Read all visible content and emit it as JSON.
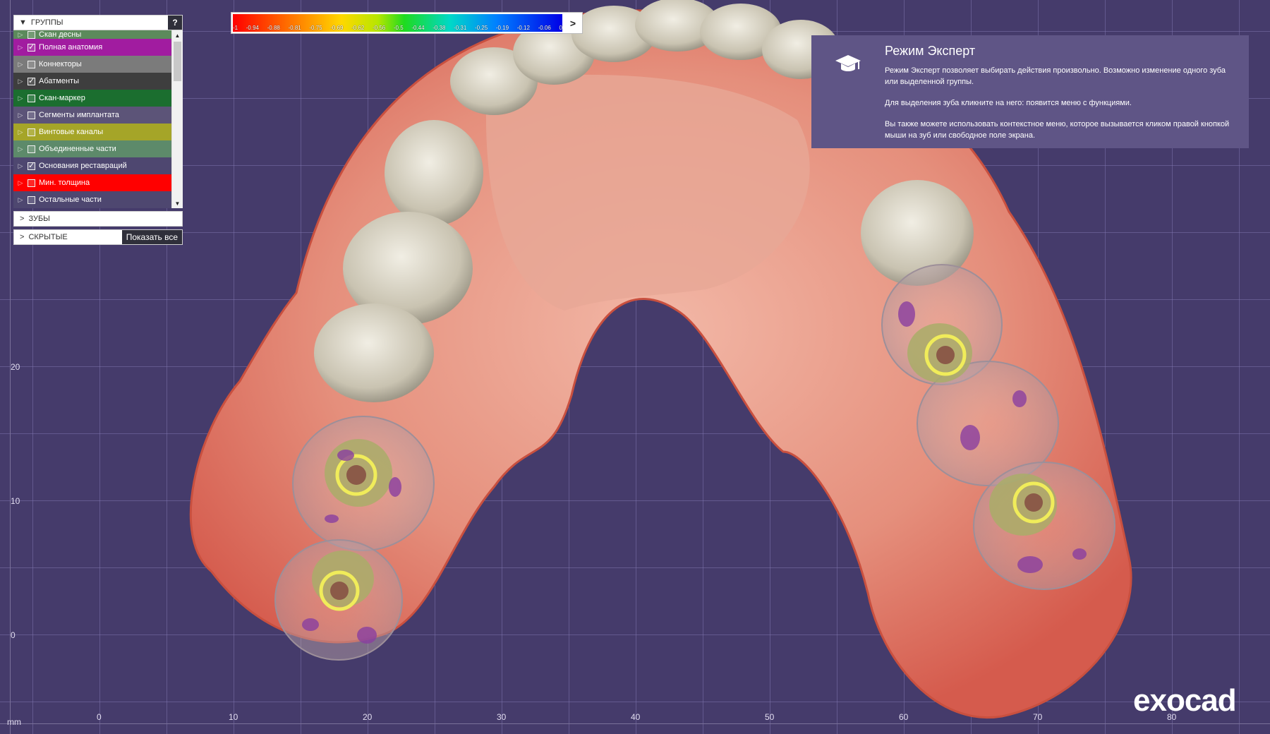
{
  "groups_panel": {
    "title": "ГРУППЫ",
    "help_label": "?",
    "partial_item": "Скан десны",
    "items": [
      {
        "label": "Полная анатомия",
        "checked": true,
        "color": "#a11ca0"
      },
      {
        "label": "Коннекторы",
        "checked": false,
        "color": "#7b7b7b"
      },
      {
        "label": "Абатменты",
        "checked": true,
        "color": "#3e3e3e"
      },
      {
        "label": "Скан-маркер",
        "checked": false,
        "color": "#1b6e2f"
      },
      {
        "label": "Сегменты имплантата",
        "checked": false,
        "color": "#5c5478"
      },
      {
        "label": "Винтовые каналы",
        "checked": false,
        "color": "#a5a528"
      },
      {
        "label": "Объединенные части",
        "checked": false,
        "color": "#5d8a6a"
      },
      {
        "label": "Основания реставраций",
        "checked": true,
        "color": "#4e4770"
      },
      {
        "label": "Мин. толщина",
        "checked": false,
        "color": "#ff0000"
      },
      {
        "label": "Остальные части",
        "checked": false,
        "color": "#4e4770"
      }
    ],
    "teeth_label": "ЗУБЫ",
    "hidden_label": "СКРЫТЫЕ",
    "show_all_label": "Показать все"
  },
  "color_scale": {
    "labels": [
      "-1",
      "-0.94",
      "-0.88",
      "-0.81",
      "-0.75",
      "-0.69",
      "-0.62",
      "-0.56",
      "-0.5",
      "-0.44",
      "-0.38",
      "-0.31",
      "-0.25",
      "-0.19",
      "-0.12",
      "-0.06",
      "0"
    ],
    "next_icon": "chevron-right-icon"
  },
  "expert_mode": {
    "icon": "graduation-cap-icon",
    "title": "Режим Эксперт",
    "paragraph1": "Режим Эксперт позволяет выбирать действия произвольно. Возможно изменение одного зуба или выделенной группы.",
    "paragraph2": "Для выделения зуба кликните на него: появится меню с функциями.",
    "paragraph3": "Вы также можете использовать контекстное меню, которое вызывается кликом правой кнопкой мыши на зуб или свободное поле экрана."
  },
  "axes": {
    "unit": "mm",
    "x_ticks": [
      "0",
      "10",
      "20",
      "30",
      "40",
      "50",
      "60",
      "70",
      "80"
    ],
    "y_ticks": [
      "20",
      "10",
      "0"
    ]
  },
  "logo": "exocad"
}
